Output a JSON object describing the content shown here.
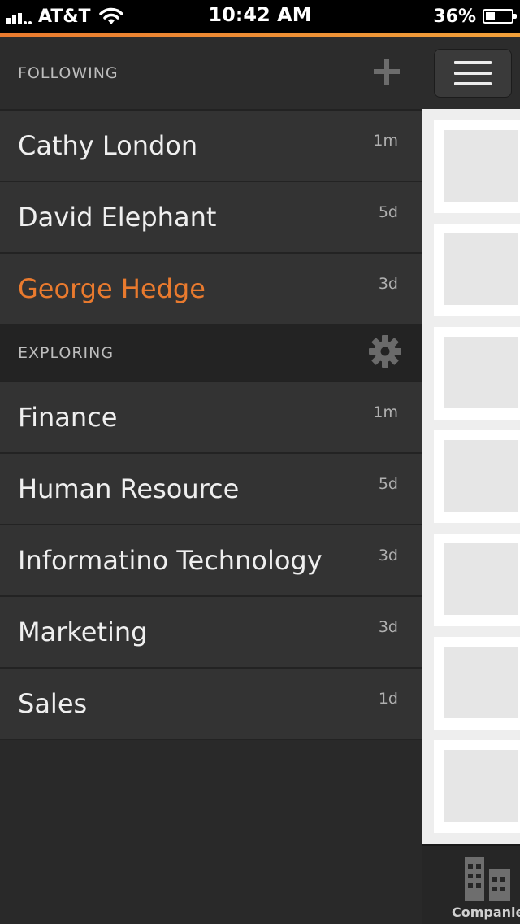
{
  "status_bar": {
    "carrier": "AT&T",
    "time": "10:42 AM",
    "battery": "36%",
    "battery_level": 0.36
  },
  "colors": {
    "accent": "#e97a2e",
    "accent_gradient_end": "#f0a03a"
  },
  "drawer": {
    "following": {
      "title": "FOLLOWING",
      "action_icon": "plus-icon",
      "items": [
        {
          "label": "Cathy London",
          "time": "1m"
        },
        {
          "label": "David Elephant",
          "time": "5d"
        },
        {
          "label": "George Hedge",
          "time": "3d",
          "active": true
        }
      ]
    },
    "exploring": {
      "title": "EXPLORING",
      "action_icon": "gear-icon",
      "items": [
        {
          "label": "Finance",
          "time": "1m"
        },
        {
          "label": "Human Resource",
          "time": "5d"
        },
        {
          "label": "Informatino Technology",
          "time": "3d"
        },
        {
          "label": "Marketing",
          "time": "3d"
        },
        {
          "label": "Sales",
          "time": "1d"
        }
      ]
    }
  },
  "content": {
    "menu_icon": "hamburger-icon",
    "tabbar": {
      "tab_label": "Companies",
      "tab_icon": "companies-icon"
    }
  }
}
